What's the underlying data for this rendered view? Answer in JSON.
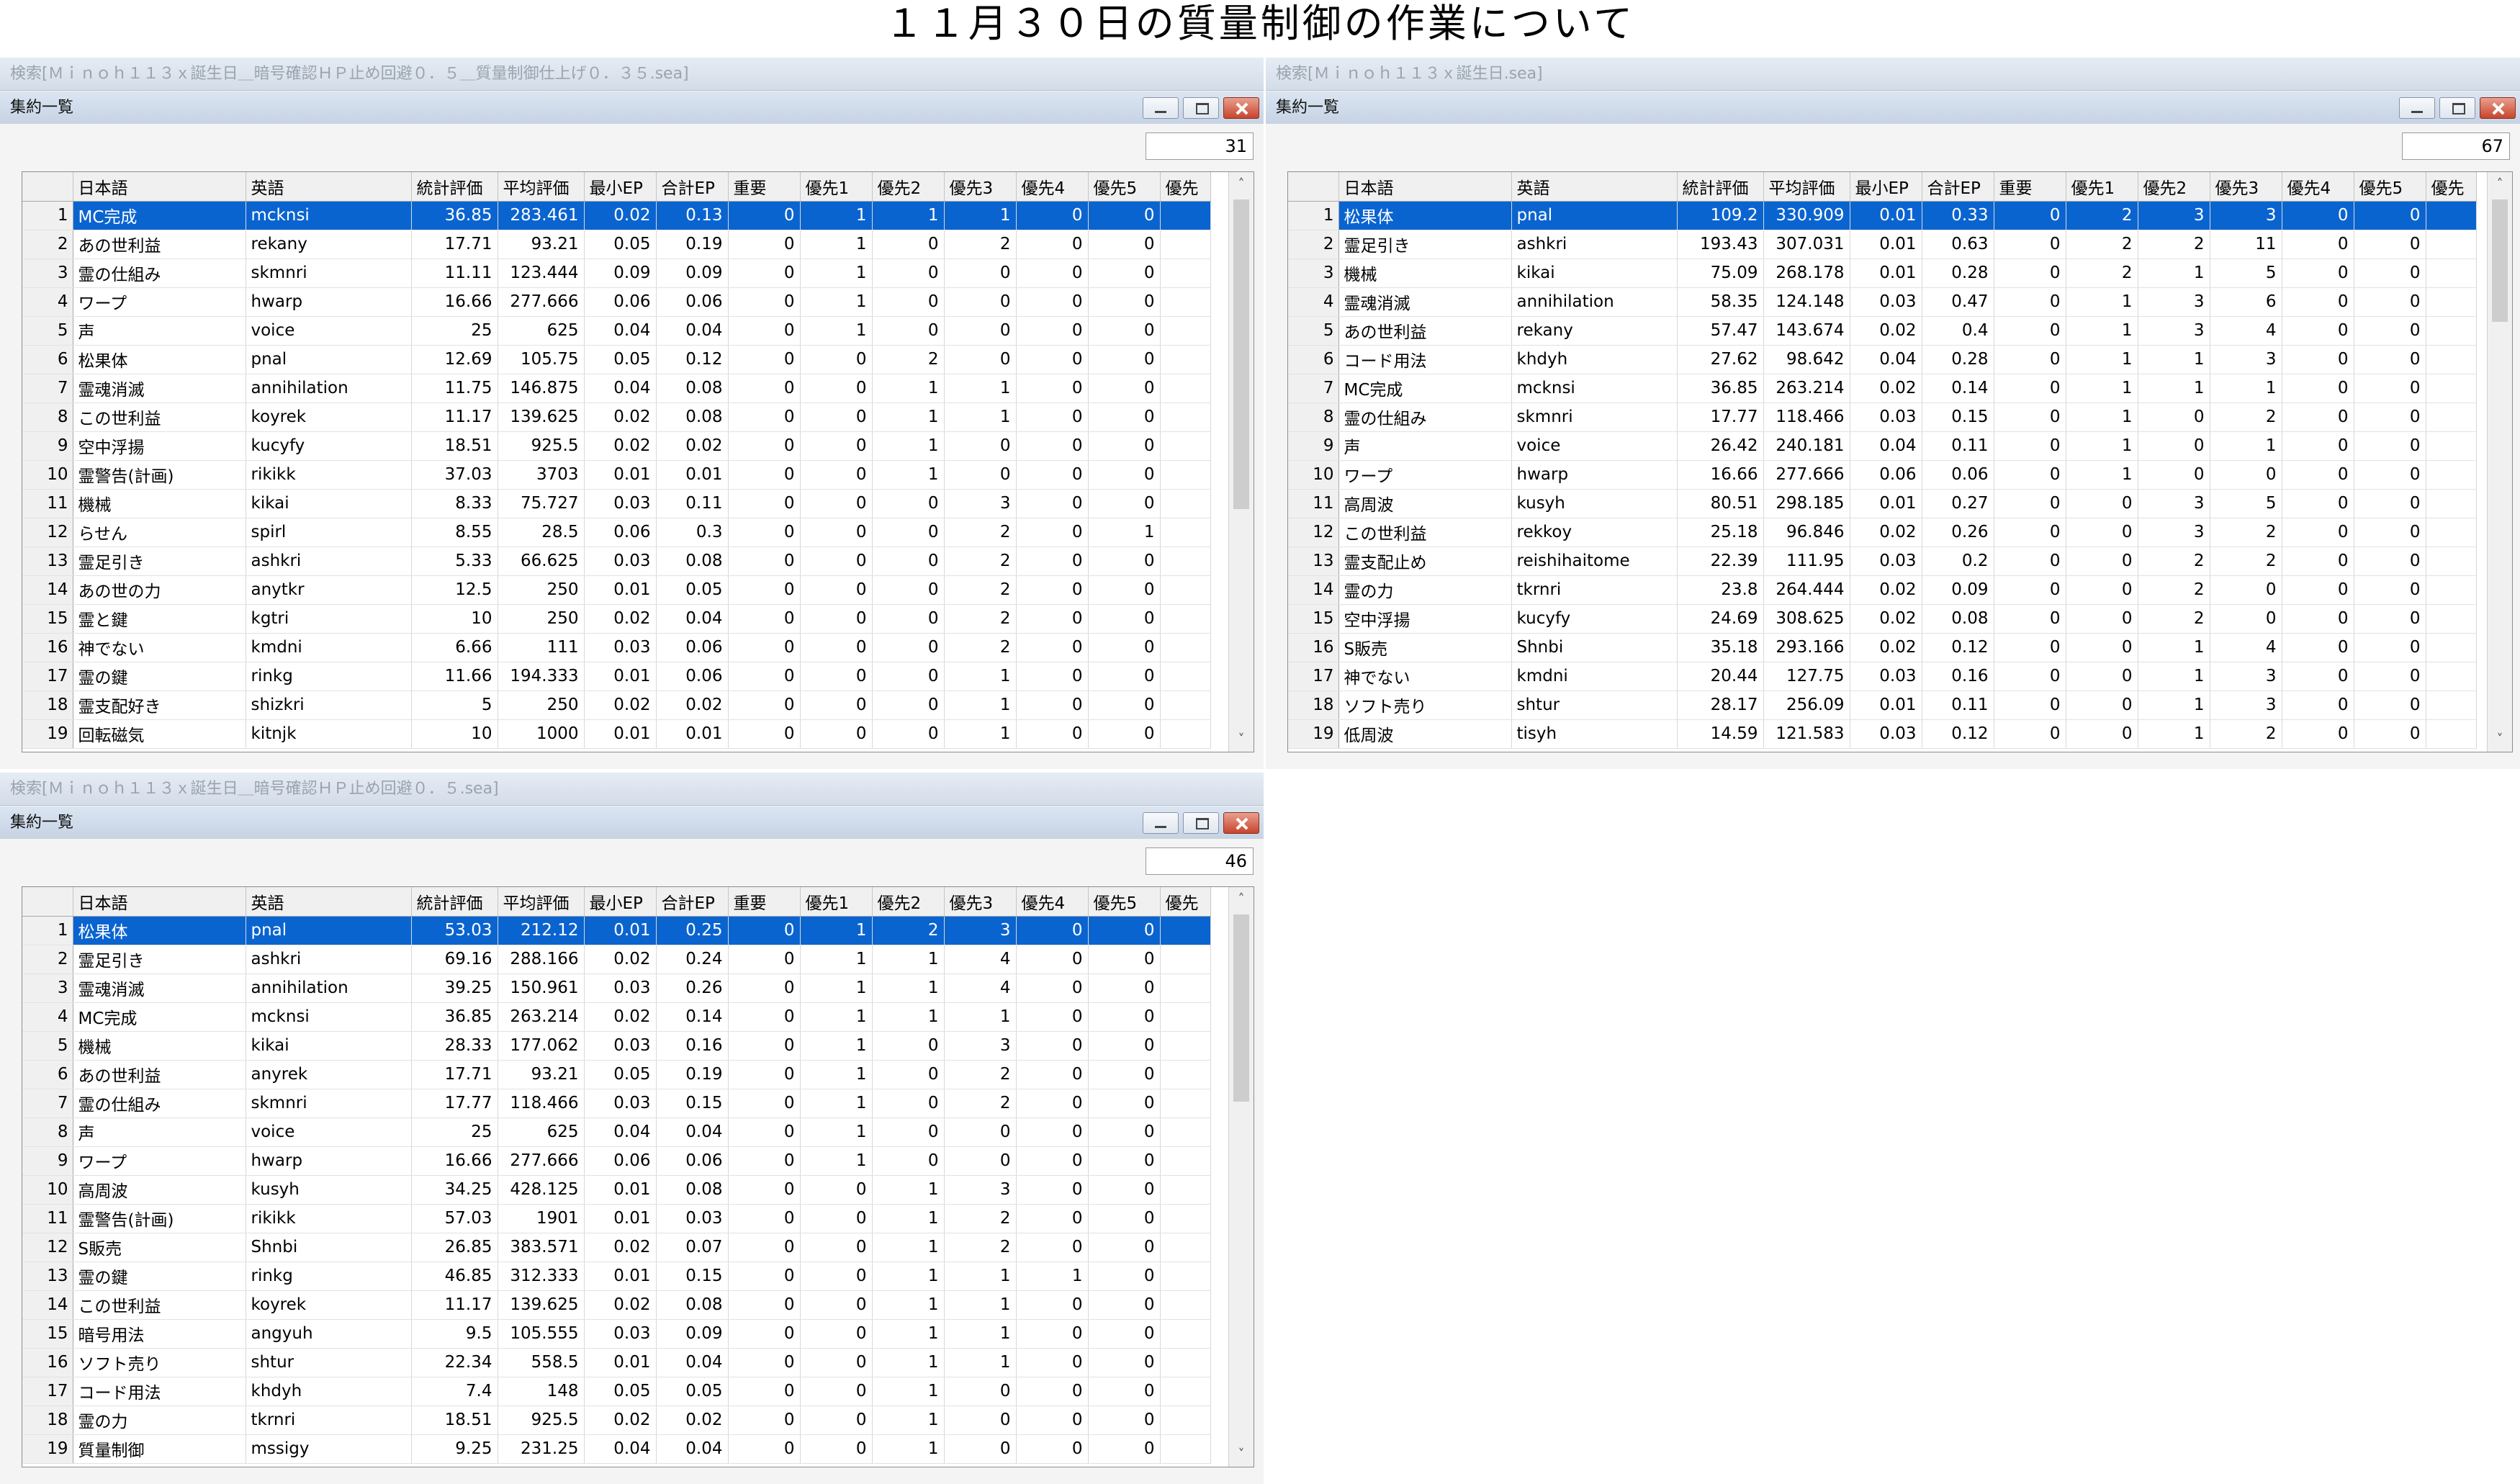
{
  "page_title": "１１月３０日の質量制御の作業について",
  "headers": [
    "日本語",
    "英語",
    "統計評価",
    "平均評価",
    "最小EP",
    "合計EP",
    "重要",
    "優先1",
    "優先2",
    "優先3",
    "優先4",
    "優先5",
    "優先"
  ],
  "panels": [
    {
      "search_title": "検索[Ｍｉｎｏｈ１１３ｘ誕生日＿暗号確認ＨＰ止め回避０．５＿質量制御仕上げ０．３５.sea]",
      "window_title": "集約一覧",
      "count": "31",
      "selected_row": 0,
      "rows": [
        [
          "1",
          "MC完成",
          "mcknsi",
          "36.85",
          "283.461",
          "0.02",
          "0.13",
          "0",
          "1",
          "1",
          "1",
          "0",
          "0"
        ],
        [
          "2",
          "あの世利益",
          "rekany",
          "17.71",
          "93.21",
          "0.05",
          "0.19",
          "0",
          "1",
          "0",
          "2",
          "0",
          "0"
        ],
        [
          "3",
          "霊の仕組み",
          "skmnri",
          "11.11",
          "123.444",
          "0.09",
          "0.09",
          "0",
          "1",
          "0",
          "0",
          "0",
          "0"
        ],
        [
          "4",
          "ワープ",
          "hwarp",
          "16.66",
          "277.666",
          "0.06",
          "0.06",
          "0",
          "1",
          "0",
          "0",
          "0",
          "0"
        ],
        [
          "5",
          "声",
          "voice",
          "25",
          "625",
          "0.04",
          "0.04",
          "0",
          "1",
          "0",
          "0",
          "0",
          "0"
        ],
        [
          "6",
          "松果体",
          "pnal",
          "12.69",
          "105.75",
          "0.05",
          "0.12",
          "0",
          "0",
          "2",
          "0",
          "0",
          "0"
        ],
        [
          "7",
          "霊魂消滅",
          "annihilation",
          "11.75",
          "146.875",
          "0.04",
          "0.08",
          "0",
          "0",
          "1",
          "1",
          "0",
          "0"
        ],
        [
          "8",
          "この世利益",
          "koyrek",
          "11.17",
          "139.625",
          "0.02",
          "0.08",
          "0",
          "0",
          "1",
          "1",
          "0",
          "0"
        ],
        [
          "9",
          "空中浮揚",
          "kucyfy",
          "18.51",
          "925.5",
          "0.02",
          "0.02",
          "0",
          "0",
          "1",
          "0",
          "0",
          "0"
        ],
        [
          "10",
          "霊警告(計画)",
          "rikikk",
          "37.03",
          "3703",
          "0.01",
          "0.01",
          "0",
          "0",
          "1",
          "0",
          "0",
          "0"
        ],
        [
          "11",
          "機械",
          "kikai",
          "8.33",
          "75.727",
          "0.03",
          "0.11",
          "0",
          "0",
          "0",
          "3",
          "0",
          "0"
        ],
        [
          "12",
          "らせん",
          "spirl",
          "8.55",
          "28.5",
          "0.06",
          "0.3",
          "0",
          "0",
          "0",
          "2",
          "0",
          "1"
        ],
        [
          "13",
          "霊足引き",
          "ashkri",
          "5.33",
          "66.625",
          "0.03",
          "0.08",
          "0",
          "0",
          "0",
          "2",
          "0",
          "0"
        ],
        [
          "14",
          "あの世の力",
          "anytkr",
          "12.5",
          "250",
          "0.01",
          "0.05",
          "0",
          "0",
          "0",
          "2",
          "0",
          "0"
        ],
        [
          "15",
          "霊と鍵",
          "kgtri",
          "10",
          "250",
          "0.02",
          "0.04",
          "0",
          "0",
          "0",
          "2",
          "0",
          "0"
        ],
        [
          "16",
          "神でない",
          "kmdni",
          "6.66",
          "111",
          "0.03",
          "0.06",
          "0",
          "0",
          "0",
          "2",
          "0",
          "0"
        ],
        [
          "17",
          "霊の鍵",
          "rinkg",
          "11.66",
          "194.333",
          "0.01",
          "0.06",
          "0",
          "0",
          "0",
          "1",
          "0",
          "0"
        ],
        [
          "18",
          "霊支配好き",
          "shizkri",
          "5",
          "250",
          "0.02",
          "0.02",
          "0",
          "0",
          "0",
          "1",
          "0",
          "0"
        ],
        [
          "19",
          "回転磁気",
          "kitnjk",
          "10",
          "1000",
          "0.01",
          "0.01",
          "0",
          "0",
          "0",
          "1",
          "0",
          "0"
        ]
      ]
    },
    {
      "search_title": "検索[Ｍｉｎｏｈ１１３ｘ誕生日.sea]",
      "window_title": "集約一覧",
      "count": "67",
      "selected_row": 0,
      "rows": [
        [
          "1",
          "松果体",
          "pnal",
          "109.2",
          "330.909",
          "0.01",
          "0.33",
          "0",
          "2",
          "3",
          "3",
          "0",
          "0"
        ],
        [
          "2",
          "霊足引き",
          "ashkri",
          "193.43",
          "307.031",
          "0.01",
          "0.63",
          "0",
          "2",
          "2",
          "11",
          "0",
          "0"
        ],
        [
          "3",
          "機械",
          "kikai",
          "75.09",
          "268.178",
          "0.01",
          "0.28",
          "0",
          "2",
          "1",
          "5",
          "0",
          "0"
        ],
        [
          "4",
          "霊魂消滅",
          "annihilation",
          "58.35",
          "124.148",
          "0.03",
          "0.47",
          "0",
          "1",
          "3",
          "6",
          "0",
          "0"
        ],
        [
          "5",
          "あの世利益",
          "rekany",
          "57.47",
          "143.674",
          "0.02",
          "0.4",
          "0",
          "1",
          "3",
          "4",
          "0",
          "0"
        ],
        [
          "6",
          "コード用法",
          "khdyh",
          "27.62",
          "98.642",
          "0.04",
          "0.28",
          "0",
          "1",
          "1",
          "3",
          "0",
          "0"
        ],
        [
          "7",
          "MC完成",
          "mcknsi",
          "36.85",
          "263.214",
          "0.02",
          "0.14",
          "0",
          "1",
          "1",
          "1",
          "0",
          "0"
        ],
        [
          "8",
          "霊の仕組み",
          "skmnri",
          "17.77",
          "118.466",
          "0.03",
          "0.15",
          "0",
          "1",
          "0",
          "2",
          "0",
          "0"
        ],
        [
          "9",
          "声",
          "voice",
          "26.42",
          "240.181",
          "0.04",
          "0.11",
          "0",
          "1",
          "0",
          "1",
          "0",
          "0"
        ],
        [
          "10",
          "ワープ",
          "hwarp",
          "16.66",
          "277.666",
          "0.06",
          "0.06",
          "0",
          "1",
          "0",
          "0",
          "0",
          "0"
        ],
        [
          "11",
          "高周波",
          "kusyh",
          "80.51",
          "298.185",
          "0.01",
          "0.27",
          "0",
          "0",
          "3",
          "5",
          "0",
          "0"
        ],
        [
          "12",
          "この世利益",
          "rekkoy",
          "25.18",
          "96.846",
          "0.02",
          "0.26",
          "0",
          "0",
          "3",
          "2",
          "0",
          "0"
        ],
        [
          "13",
          "霊支配止め",
          "reishihaitome",
          "22.39",
          "111.95",
          "0.03",
          "0.2",
          "0",
          "0",
          "2",
          "2",
          "0",
          "0"
        ],
        [
          "14",
          "霊の力",
          "tkrnri",
          "23.8",
          "264.444",
          "0.02",
          "0.09",
          "0",
          "0",
          "2",
          "0",
          "0",
          "0"
        ],
        [
          "15",
          "空中浮揚",
          "kucyfy",
          "24.69",
          "308.625",
          "0.02",
          "0.08",
          "0",
          "0",
          "2",
          "0",
          "0",
          "0"
        ],
        [
          "16",
          "S販売",
          "Shnbi",
          "35.18",
          "293.166",
          "0.02",
          "0.12",
          "0",
          "0",
          "1",
          "4",
          "0",
          "0"
        ],
        [
          "17",
          "神でない",
          "kmdni",
          "20.44",
          "127.75",
          "0.03",
          "0.16",
          "0",
          "0",
          "1",
          "3",
          "0",
          "0"
        ],
        [
          "18",
          "ソフト売り",
          "shtur",
          "28.17",
          "256.09",
          "0.01",
          "0.11",
          "0",
          "0",
          "1",
          "3",
          "0",
          "0"
        ],
        [
          "19",
          "低周波",
          "tisyh",
          "14.59",
          "121.583",
          "0.03",
          "0.12",
          "0",
          "0",
          "1",
          "2",
          "0",
          "0"
        ]
      ]
    },
    {
      "search_title": "検索[Ｍｉｎｏｈ１１３ｘ誕生日＿暗号確認ＨＰ止め回避０．５.sea]",
      "window_title": "集約一覧",
      "count": "46",
      "selected_row": 0,
      "rows": [
        [
          "1",
          "松果体",
          "pnal",
          "53.03",
          "212.12",
          "0.01",
          "0.25",
          "0",
          "1",
          "2",
          "3",
          "0",
          "0"
        ],
        [
          "2",
          "霊足引き",
          "ashkri",
          "69.16",
          "288.166",
          "0.02",
          "0.24",
          "0",
          "1",
          "1",
          "4",
          "0",
          "0"
        ],
        [
          "3",
          "霊魂消滅",
          "annihilation",
          "39.25",
          "150.961",
          "0.03",
          "0.26",
          "0",
          "1",
          "1",
          "4",
          "0",
          "0"
        ],
        [
          "4",
          "MC完成",
          "mcknsi",
          "36.85",
          "263.214",
          "0.02",
          "0.14",
          "0",
          "1",
          "1",
          "1",
          "0",
          "0"
        ],
        [
          "5",
          "機械",
          "kikai",
          "28.33",
          "177.062",
          "0.03",
          "0.16",
          "0",
          "1",
          "0",
          "3",
          "0",
          "0"
        ],
        [
          "6",
          "あの世利益",
          "anyrek",
          "17.71",
          "93.21",
          "0.05",
          "0.19",
          "0",
          "1",
          "0",
          "2",
          "0",
          "0"
        ],
        [
          "7",
          "霊の仕組み",
          "skmnri",
          "17.77",
          "118.466",
          "0.03",
          "0.15",
          "0",
          "1",
          "0",
          "2",
          "0",
          "0"
        ],
        [
          "8",
          "声",
          "voice",
          "25",
          "625",
          "0.04",
          "0.04",
          "0",
          "1",
          "0",
          "0",
          "0",
          "0"
        ],
        [
          "9",
          "ワープ",
          "hwarp",
          "16.66",
          "277.666",
          "0.06",
          "0.06",
          "0",
          "1",
          "0",
          "0",
          "0",
          "0"
        ],
        [
          "10",
          "高周波",
          "kusyh",
          "34.25",
          "428.125",
          "0.01",
          "0.08",
          "0",
          "0",
          "1",
          "3",
          "0",
          "0"
        ],
        [
          "11",
          "霊警告(計画)",
          "rikikk",
          "57.03",
          "1901",
          "0.01",
          "0.03",
          "0",
          "0",
          "1",
          "2",
          "0",
          "0"
        ],
        [
          "12",
          "S販売",
          "Shnbi",
          "26.85",
          "383.571",
          "0.02",
          "0.07",
          "0",
          "0",
          "1",
          "2",
          "0",
          "0"
        ],
        [
          "13",
          "霊の鍵",
          "rinkg",
          "46.85",
          "312.333",
          "0.01",
          "0.15",
          "0",
          "0",
          "1",
          "1",
          "1",
          "0"
        ],
        [
          "14",
          "この世利益",
          "koyrek",
          "11.17",
          "139.625",
          "0.02",
          "0.08",
          "0",
          "0",
          "1",
          "1",
          "0",
          "0"
        ],
        [
          "15",
          "暗号用法",
          "angyuh",
          "9.5",
          "105.555",
          "0.03",
          "0.09",
          "0",
          "0",
          "1",
          "1",
          "0",
          "0"
        ],
        [
          "16",
          "ソフト売り",
          "shtur",
          "22.34",
          "558.5",
          "0.01",
          "0.04",
          "0",
          "0",
          "1",
          "1",
          "0",
          "0"
        ],
        [
          "17",
          "コード用法",
          "khdyh",
          "7.4",
          "148",
          "0.05",
          "0.05",
          "0",
          "0",
          "1",
          "0",
          "0",
          "0"
        ],
        [
          "18",
          "霊の力",
          "tkrnri",
          "18.51",
          "925.5",
          "0.02",
          "0.02",
          "0",
          "0",
          "1",
          "0",
          "0",
          "0"
        ],
        [
          "19",
          "質量制御",
          "mssigy",
          "9.25",
          "231.25",
          "0.04",
          "0.04",
          "0",
          "0",
          "1",
          "0",
          "0",
          "0"
        ]
      ]
    }
  ]
}
